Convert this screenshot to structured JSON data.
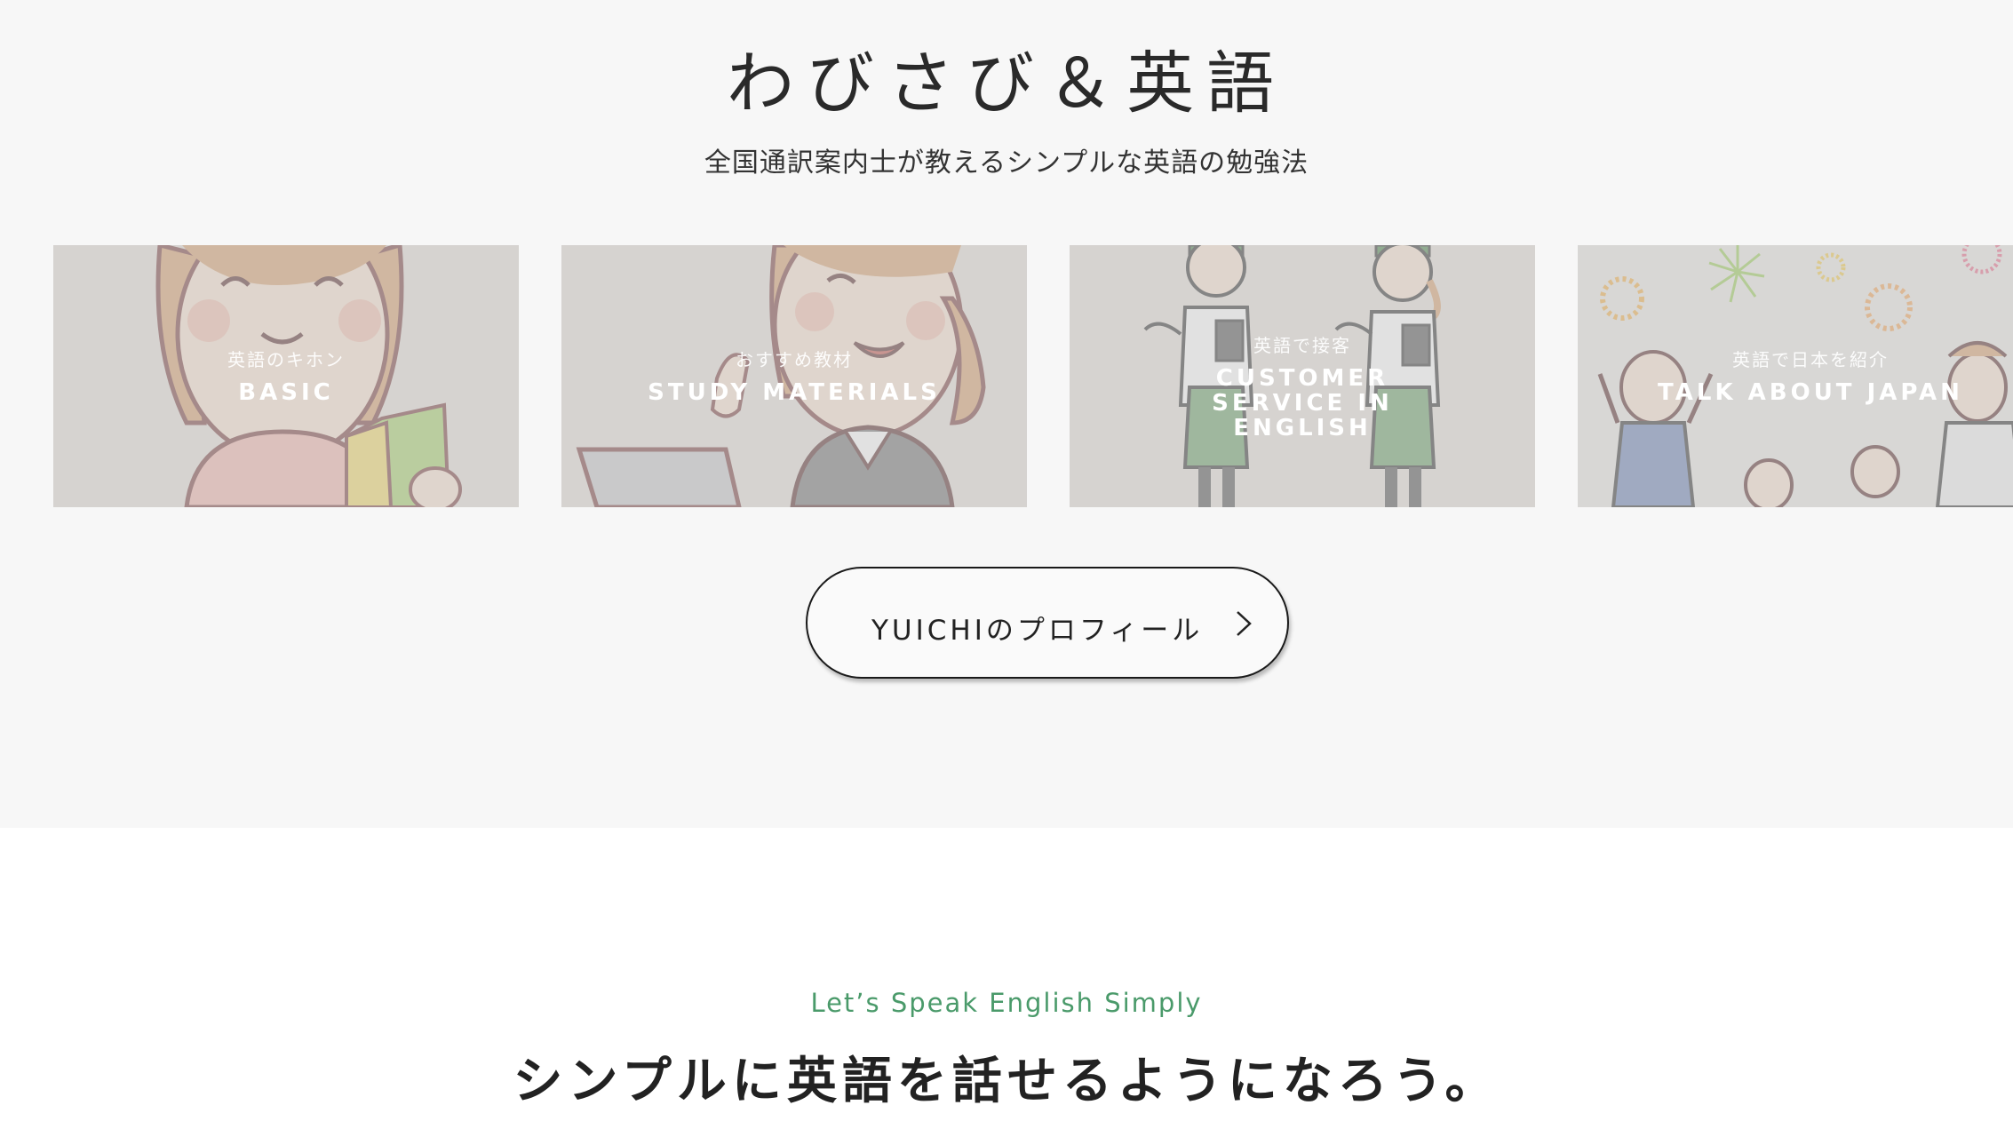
{
  "hero": {
    "title": "わびさび＆英語",
    "subtitle": "全国通訳案内士が教えるシンプルな英語の勉強法"
  },
  "cards": [
    {
      "jp": "英語のキホン",
      "en": "BASIC"
    },
    {
      "jp": "おすすめ教材",
      "en": "STUDY MATERIALS"
    },
    {
      "jp": "英語で接客",
      "en": "CUSTOMER SERVICE IN ENGLISH"
    },
    {
      "jp": "英語で日本を紹介",
      "en": "TALK ABOUT JAPAN"
    }
  ],
  "profile_button": {
    "label": "YUICHIのプロフィール",
    "icon": "chevron-right-icon"
  },
  "section": {
    "lead": "Let’s Speak English Simply",
    "heading": "シンプルに英語を話せるようになろう。"
  },
  "colors": {
    "accent_green": "#4a9a6a",
    "hero_bg": "#f7f7f7"
  }
}
